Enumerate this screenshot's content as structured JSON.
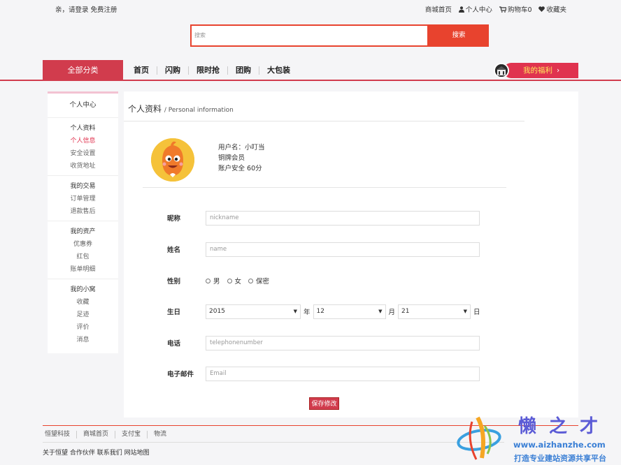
{
  "topbar": {
    "greeting": "亲，请登录 免费注册",
    "links": [
      "商城首页",
      "个人中心",
      "购物车0",
      "收藏夹"
    ]
  },
  "search": {
    "placeholder": "搜索",
    "button": "搜索"
  },
  "nav": {
    "all_categories": "全部分类",
    "items": [
      "首页",
      "闪购",
      "限时抢",
      "团购",
      "大包装"
    ],
    "welfare": "我的福利"
  },
  "sidebar": {
    "title": "个人中心",
    "groups": [
      {
        "title": "个人资料",
        "items": [
          "个人信息",
          "安全设置",
          "收货地址"
        ]
      },
      {
        "title": "我的交易",
        "items": [
          "订单管理",
          "退款售后"
        ]
      },
      {
        "title": "我的资产",
        "items": [
          "优惠券",
          "红包",
          "账单明细"
        ]
      },
      {
        "title": "我的小窝",
        "items": [
          "收藏",
          "足迹",
          "评价",
          "消息"
        ]
      }
    ]
  },
  "main": {
    "title": "个人资料",
    "subtitle": "/ Personal information",
    "user": {
      "username_label": "用户名：",
      "username": "小叮当",
      "level": "铜牌会员",
      "security": "账户安全 60分"
    },
    "form": {
      "nickname_label": "昵称",
      "nickname_placeholder": "nickname",
      "name_label": "姓名",
      "name_placeholder": "name",
      "gender_label": "性别",
      "gender_options": [
        "男",
        "女",
        "保密"
      ],
      "birthday_label": "生日",
      "year": "2015",
      "year_unit": "年",
      "month": "12",
      "month_unit": "月",
      "day": "21",
      "day_unit": "日",
      "phone_label": "电话",
      "phone_placeholder": "telephonenumber",
      "email_label": "电子邮件",
      "email_placeholder": "Email",
      "save": "保存修改"
    }
  },
  "footer": {
    "links": [
      "恒望科技",
      "商城首页",
      "支付宝",
      "物流"
    ],
    "about": "关于恒望 合作伙伴 联系我们 网站地图"
  },
  "watermark": {
    "brand": "懒之才",
    "url": "www.aizhanzhe.com",
    "slogan": "打造专业建站资源共享平台"
  },
  "colors": {
    "accent": "#d13c4d",
    "search": "#e8432e",
    "welfare_text": "#ffe45c"
  }
}
